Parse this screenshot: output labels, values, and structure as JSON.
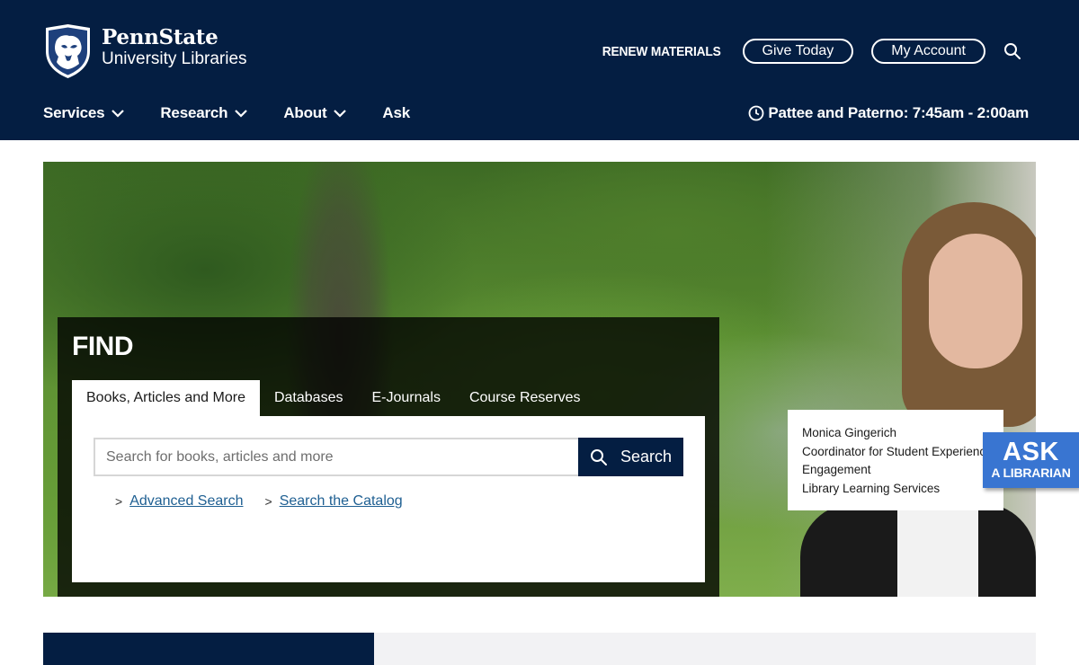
{
  "header": {
    "logo": {
      "line1": "PennState",
      "line2": "University Libraries"
    },
    "renew_label": "RENEW MATERIALS",
    "give_label": "Give Today",
    "account_label": "My Account",
    "nav": [
      {
        "label": "Services",
        "has_dropdown": true
      },
      {
        "label": "Research",
        "has_dropdown": true
      },
      {
        "label": "About",
        "has_dropdown": true
      },
      {
        "label": "Ask",
        "has_dropdown": false
      }
    ],
    "hours": "Pattee and Paterno: 7:45am - 2:00am",
    "colors": {
      "navy": "#041e42",
      "link": "#1e5f92",
      "ask_blue": "#3975d1"
    }
  },
  "find": {
    "title": "FIND",
    "tabs": [
      {
        "label": "Books, Articles and More",
        "active": true
      },
      {
        "label": "Databases",
        "active": false
      },
      {
        "label": "E-Journals",
        "active": false
      },
      {
        "label": "Course Reserves",
        "active": false
      }
    ],
    "search": {
      "placeholder": "Search for books, articles and more",
      "button_label": "Search"
    },
    "links": [
      {
        "caret": ">",
        "label": "Advanced Search"
      },
      {
        "caret": ">",
        "label": "Search the Catalog"
      }
    ]
  },
  "caption": {
    "name": "Monica Gingerich",
    "title_line1": "Coordinator for Student Experience",
    "title_line2": "Engagement",
    "department": "Library Learning Services"
  },
  "ask": {
    "line1": "ASK",
    "line2": "A LIBRARIAN"
  }
}
